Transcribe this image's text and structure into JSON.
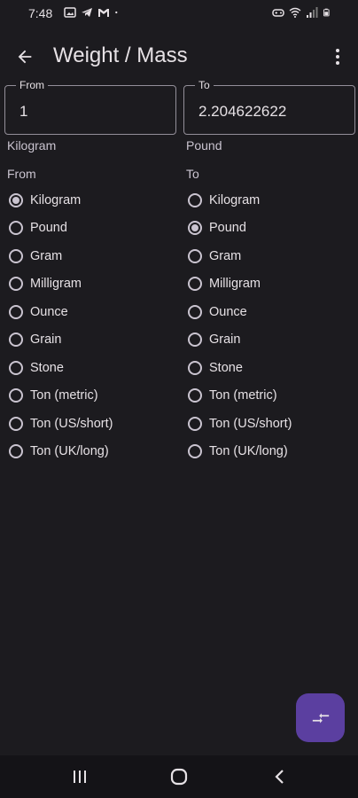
{
  "status": {
    "time": "7:48",
    "left_icons": [
      "photo-icon",
      "telegram-icon",
      "gmail-icon",
      "dot-icon"
    ],
    "right_icons": [
      "gamepad-icon",
      "wifi-icon",
      "signal-icon",
      "battery-icon"
    ]
  },
  "app_bar": {
    "title": "Weight / Mass",
    "back_icon": "arrow-back-icon",
    "menu_icon": "more-vert-icon"
  },
  "from": {
    "label": "From",
    "value": "1",
    "unit": "Kilogram",
    "heading": "From"
  },
  "to": {
    "label": "To",
    "value": "2.204622622",
    "unit": "Pound",
    "heading": "To"
  },
  "units": {
    "from": [
      {
        "label": "Kilogram",
        "checked": true
      },
      {
        "label": "Pound",
        "checked": false
      },
      {
        "label": "Gram",
        "checked": false
      },
      {
        "label": "Milligram",
        "checked": false
      },
      {
        "label": "Ounce",
        "checked": false
      },
      {
        "label": "Grain",
        "checked": false
      },
      {
        "label": "Stone",
        "checked": false
      },
      {
        "label": "Ton (metric)",
        "checked": false
      },
      {
        "label": "Ton (US/short)",
        "checked": false
      },
      {
        "label": "Ton (UK/long)",
        "checked": false
      }
    ],
    "to": [
      {
        "label": "Kilogram",
        "checked": false
      },
      {
        "label": "Pound",
        "checked": true
      },
      {
        "label": "Gram",
        "checked": false
      },
      {
        "label": "Milligram",
        "checked": false
      },
      {
        "label": "Ounce",
        "checked": false
      },
      {
        "label": "Grain",
        "checked": false
      },
      {
        "label": "Stone",
        "checked": false
      },
      {
        "label": "Ton (metric)",
        "checked": false
      },
      {
        "label": "Ton (US/short)",
        "checked": false
      },
      {
        "label": "Ton (UK/long)",
        "checked": false
      }
    ]
  },
  "fab": {
    "icon": "swap-icon"
  },
  "nav": {
    "recents_icon": "recents-icon",
    "home_icon": "home-icon",
    "back_icon": "nav-back-icon"
  },
  "colors": {
    "background": "#1c1b1f",
    "fab": "#5b3fa0",
    "text": "#e6e1e5"
  }
}
